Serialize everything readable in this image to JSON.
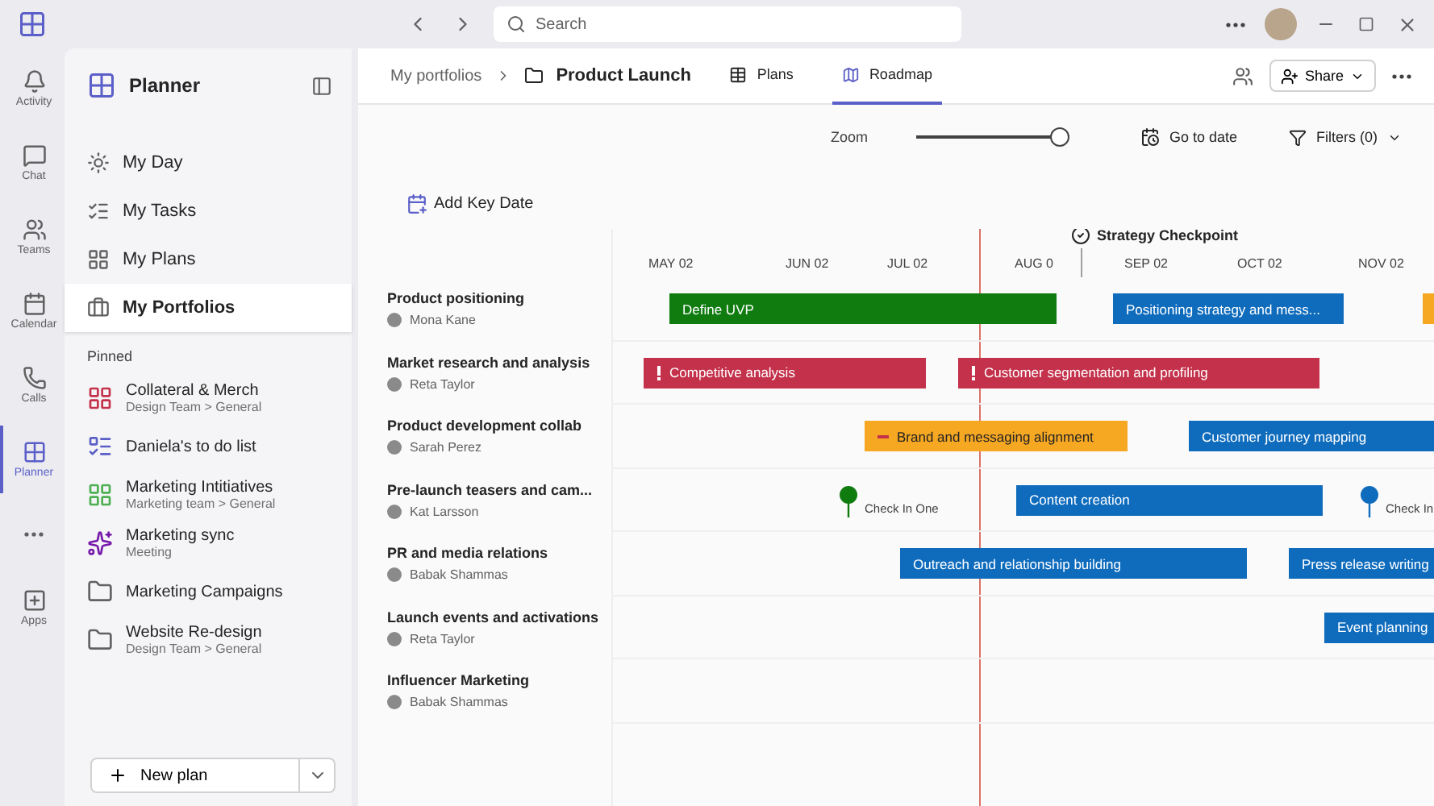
{
  "titlebar": {
    "search": {
      "placeholder": "Search"
    }
  },
  "rail": [
    {
      "label": "Activity",
      "selected": false
    },
    {
      "label": "Chat",
      "selected": false
    },
    {
      "label": "Teams",
      "selected": false
    },
    {
      "label": "Calendar",
      "selected": false
    },
    {
      "label": "Calls",
      "selected": false
    },
    {
      "label": "Planner",
      "selected": true
    },
    {
      "selected": false
    },
    {
      "label": "Apps",
      "selected": false
    }
  ],
  "sidebar": {
    "title": "Planner",
    "nav": [
      {
        "label": "My Day",
        "selected": false
      },
      {
        "label": "My Tasks",
        "selected": false
      },
      {
        "label": "My Plans",
        "selected": false
      },
      {
        "label": "My Portfolios",
        "selected": true
      }
    ],
    "section": "Pinned",
    "pinned": [
      {
        "kind": "plan",
        "title": "Collateral & Merch",
        "subtitle": "Design Team > General"
      },
      {
        "kind": "list",
        "title": "Daniela's to do list"
      },
      {
        "kind": "plan",
        "title": "Marketing Intitiatives",
        "subtitle": "Marketing team > General"
      },
      {
        "kind": "meeting",
        "title": "Marketing sync",
        "subtitle": "Meeting"
      },
      {
        "kind": "folder",
        "title": "Marketing Campaigns"
      },
      {
        "kind": "folder",
        "title": "Website Re-design",
        "subtitle": "Design Team > General"
      }
    ],
    "new_plan": "New plan"
  },
  "header": {
    "breadcrumb": [
      "My portfolios",
      "Product Launch"
    ],
    "tabs": [
      {
        "label": "Plans",
        "selected": false
      },
      {
        "label": "Roadmap",
        "selected": true
      }
    ],
    "share": "Share"
  },
  "toolbar": {
    "zoom": {
      "label": "Zoom",
      "level": 1
    },
    "go_to_date": "Go to date",
    "filters": "Filters (0)"
  },
  "add_key_date": "Add Key Date",
  "timeline": {
    "key_date": "Strategy Checkpoint",
    "months": [
      "MAY 02",
      "JUN 02",
      "JUL 02",
      "AUG 0",
      "SEP 02",
      "OCT 02",
      "NOV 02"
    ],
    "rows": [
      {
        "name": "Product positioning",
        "owner": "Mona Kane",
        "items": [
          {
            "kind": "bar",
            "label": "Define UVP",
            "color": "#107c10"
          },
          {
            "kind": "bar",
            "label": "Positioning strategy and mess...",
            "color": "#0f6cbd"
          },
          {
            "kind": "bar",
            "color": "#f7a823"
          }
        ]
      },
      {
        "name": "Market research and analysis",
        "owner": "Reta Taylor",
        "items": [
          {
            "kind": "urgent-bar",
            "label": "Competitive analysis",
            "color": "#c4314b"
          },
          {
            "kind": "urgent-bar",
            "label": "Customer segmentation and profiling",
            "color": "#c4314b"
          }
        ]
      },
      {
        "name": "Product development collab",
        "owner": "Sarah Perez",
        "items": [
          {
            "kind": "minus-bar",
            "label": "Brand and messaging alignment",
            "color": "#f7a823"
          },
          {
            "kind": "bar",
            "label": "Customer journey mapping",
            "color": "#0f6cbd"
          }
        ]
      },
      {
        "name": "Pre-launch teasers and cam...",
        "owner": "Kat Larsson",
        "items": [
          {
            "kind": "milestone",
            "label": "Check In One",
            "color": "#107c10"
          },
          {
            "kind": "bar",
            "label": "Content creation",
            "color": "#0f6cbd"
          },
          {
            "kind": "milestone",
            "label": "Check In",
            "color": "#0f6cbd"
          }
        ]
      },
      {
        "name": "PR and media relations",
        "owner": "Babak Shammas",
        "items": [
          {
            "kind": "bar",
            "label": "Outreach and relationship building",
            "color": "#0f6cbd"
          },
          {
            "kind": "bar",
            "label": "Press release writing",
            "color": "#0f6cbd"
          }
        ]
      },
      {
        "name": "Launch events and activations",
        "owner": "Reta Taylor",
        "items": [
          {
            "kind": "bar",
            "label": "Event planning",
            "color": "#0f6cbd"
          }
        ]
      },
      {
        "name": "Influencer Marketing",
        "owner": "Babak Shammas",
        "items": []
      }
    ]
  }
}
